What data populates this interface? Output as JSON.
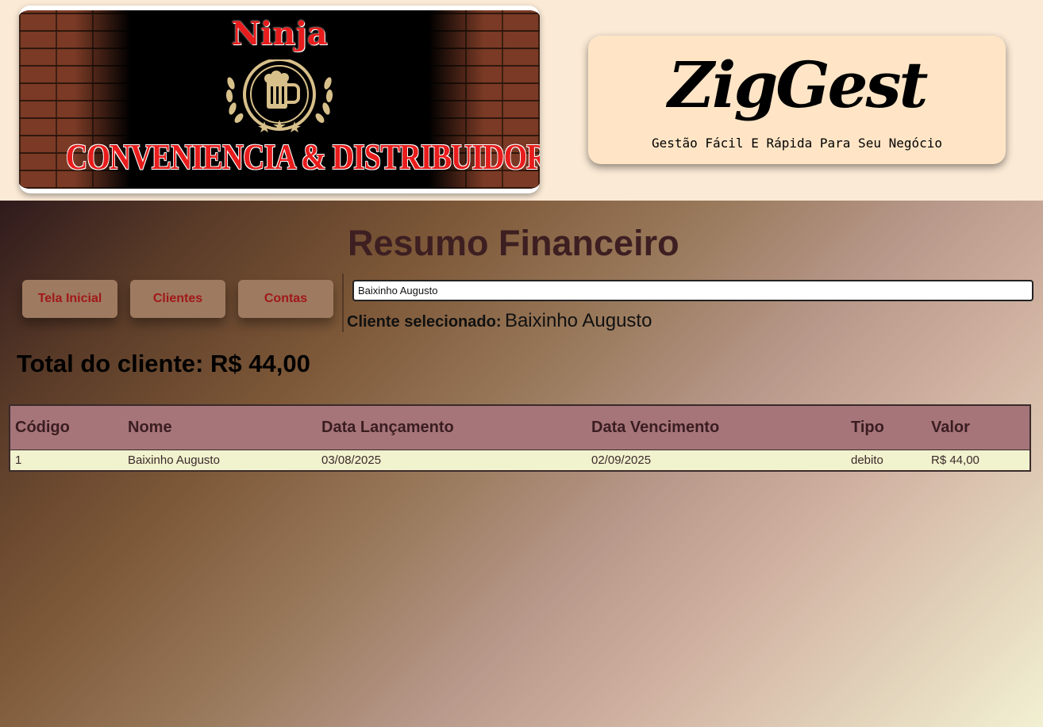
{
  "logo": {
    "top_text": "Ninja",
    "bottom_text": "CONVENIENCIA & DISTRIBUIDORA"
  },
  "brand": {
    "name": "ZigGest",
    "tagline": "Gestão Fácil E Rápida Para Seu Negócio"
  },
  "page": {
    "title": "Resumo Financeiro"
  },
  "nav": {
    "home": "Tela Inicial",
    "clients": "Clientes",
    "accounts": "Contas"
  },
  "search": {
    "value": "Baixinho Augusto"
  },
  "selected": {
    "label": "Cliente selecionado:",
    "value": "Baixinho Augusto"
  },
  "total": {
    "text": "Total do cliente: R$ 44,00"
  },
  "table": {
    "headers": [
      "Código",
      "Nome",
      "Data Lançamento",
      "Data Vencimento",
      "Tipo",
      "Valor"
    ],
    "rows": [
      [
        "1",
        "Baixinho Augusto",
        "03/08/2025",
        "02/09/2025",
        "debito",
        "R$ 44,00"
      ]
    ]
  },
  "colors": {
    "header_bg": "#fbead6",
    "brand_card": "#ffe5c6",
    "table_header": "#a67579",
    "table_row": "#f1f2ce",
    "button_bg": "#9e7a60",
    "button_text": "#a11818",
    "logo_red": "#e81c1c"
  },
  "icons": [
    "beer-mug-icon",
    "laurel-left-icon",
    "laurel-right-icon",
    "star-icon"
  ]
}
